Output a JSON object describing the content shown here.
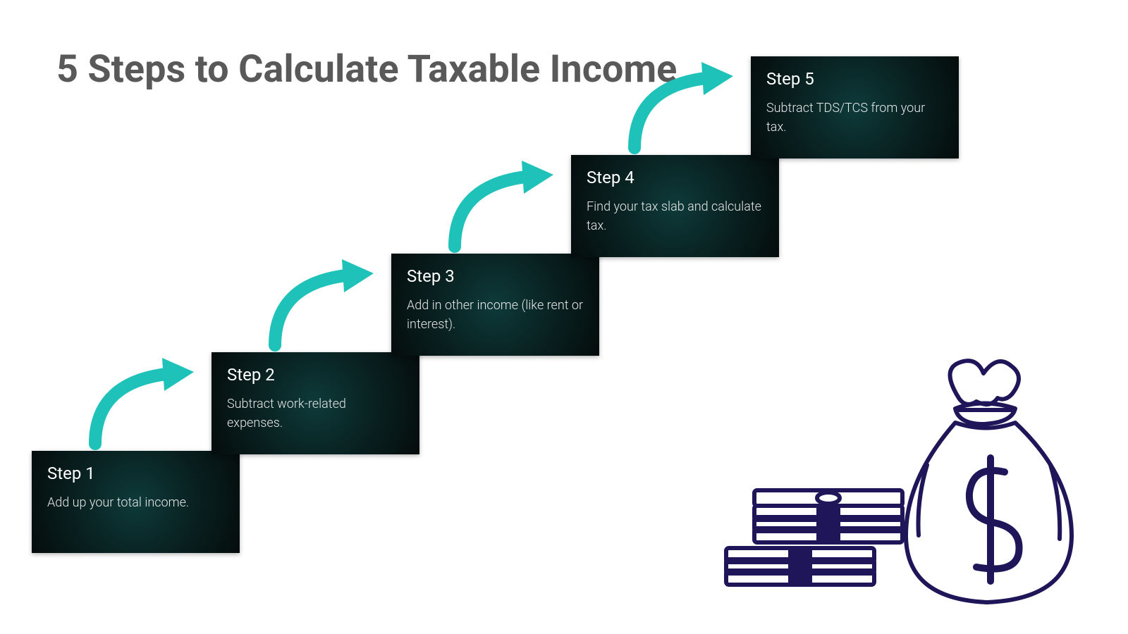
{
  "title": "5 Steps to Calculate Taxable Income",
  "steps": [
    {
      "label": "Step 1",
      "desc": "Add up your total income."
    },
    {
      "label": "Step 2",
      "desc": "Subtract work-related expenses."
    },
    {
      "label": "Step 3",
      "desc": "Add in other income (like rent or interest)."
    },
    {
      "label": "Step 4",
      "desc": "Find your tax slab and calculate tax."
    },
    {
      "label": "Step 5",
      "desc": "Subtract TDS/TCS from your tax."
    }
  ],
  "colors": {
    "arrow": "#1fc2b8",
    "title": "#595959",
    "illustration": "#1f1559"
  }
}
